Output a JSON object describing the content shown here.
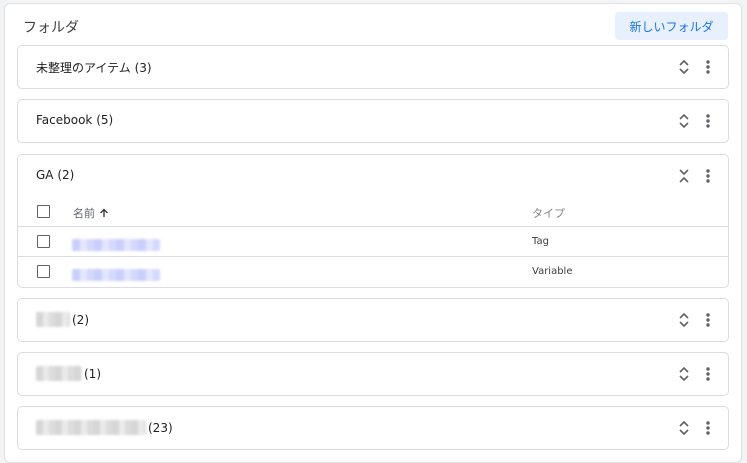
{
  "header": {
    "title": "フォルダ",
    "new_folder_label": "新しいフォルダ"
  },
  "table_columns": {
    "name": "名前",
    "sort_icon": "arrow-up-icon",
    "type": "タイプ"
  },
  "folders": [
    {
      "label": "未整理のアイテム (3)",
      "expanded": false
    },
    {
      "label": "Facebook (5)",
      "expanded": false
    },
    {
      "label": "GA (2)",
      "expanded": true,
      "rows": [
        {
          "type": "Tag"
        },
        {
          "type": "Variable"
        }
      ]
    },
    {
      "label": "(2)",
      "expanded": false
    },
    {
      "label": "(1)",
      "expanded": false
    },
    {
      "label": "(23)",
      "expanded": false
    }
  ],
  "colors": {
    "accent": "#1a73e8",
    "button_bg": "#e8f0fe",
    "border": "#dadce0"
  }
}
